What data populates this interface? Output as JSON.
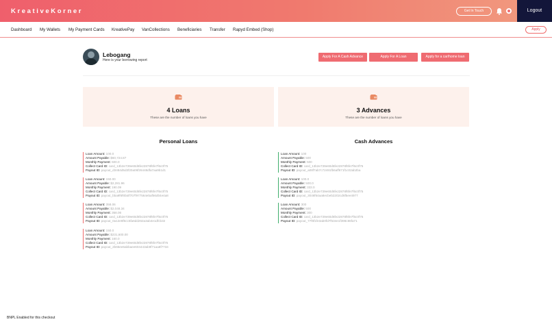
{
  "header": {
    "brand": "KreativeKorner",
    "get_in_touch": "Get In Touch",
    "logout": "Logout"
  },
  "nav": {
    "items": [
      "Dashboard",
      "My Wallets",
      "My Payment Cards",
      "KreativePay",
      "VanCollections",
      "Beneficiaries",
      "Transfer",
      "Rapyd Embed (Shop)"
    ],
    "apply": "Apply"
  },
  "profile": {
    "name": "Lebogang",
    "subtitle": "Here is your borrowing report"
  },
  "actions": [
    "Apply For A Cash Advance",
    "Apply For A Loan",
    "Apply for a car/home loan"
  ],
  "summary": {
    "loans_count": "4 Loans",
    "loans_desc": "These are the number of loans you have",
    "advances_count": "3 Advances",
    "advances_desc": "These are the number of loans you have"
  },
  "sections": {
    "loans_title": "Personal Loans",
    "advances_title": "Cash Advances"
  },
  "labels": {
    "loan_amount": "Loan Amount:",
    "amount_payable": "Amount Payable:",
    "monthly_payment": "Monthly Payment:",
    "collect_card": "Collect Card ID:",
    "payout": "Payout ID:"
  },
  "loans": [
    {
      "loan_amount": "100.0",
      "amount_payable": "$60,724.87",
      "monthly_payment": "600.0",
      "collect_card": "card_13b2e739e60d6fe22878f6fe7f6c0f75",
      "payout": "payout_d3484d5d3f20a06f26448dfa7aa9b1d1"
    },
    {
      "loan_amount": "150.00",
      "amount_payable": "$2,281.96",
      "monthly_payment": "190.09",
      "collect_card": "card_13b2e739e60d6fe22878f6fe7f6c0f75",
      "payout": "payout_bba9f6f6fa0f707f977564ebaf56d04e4a8"
    },
    {
      "loan_amount": "358.06",
      "amount_payable": "$2,048.34",
      "monthly_payment": "358.06",
      "collect_card": "card_13b2e739e60d6fe22878f6fe7f6c0f75",
      "payout": "payout_0a12e8f6cc5fa6dd262a3ab4e1dfcb32"
    },
    {
      "loan_amount": "150.0",
      "amount_payable": "$231,600.00",
      "monthly_payment": "160.0",
      "collect_card": "card_13b2e739e60d6fe22878f6fe7f6c0f75",
      "payout": "payout_2b65ee6abbaee604443ab9f71aa8f7734"
    }
  ],
  "advances": [
    {
      "loan_amount": "100",
      "amount_payable": "500",
      "monthly_payment": "500",
      "collect_card": "card_13b2e739e60d6fe22878f6fe7f6c0f75",
      "payout": "payout_a08f7ab7c72491fb6aff671f1c02ab2ba"
    },
    {
      "loan_amount": "100.0",
      "amount_payable": "500.0",
      "monthly_payment": "333.0",
      "collect_card": "card_13b2e739e60d6fe22878f6fe7f6c0f75",
      "payout": "payout_3046f64aa8ecbeb2202cd6f5ee4977"
    },
    {
      "loan_amount": "300",
      "amount_payable": "500",
      "monthly_payment": "300",
      "collect_card": "card_13b2e739e60d6fe22878f6fe7f6c0f75",
      "payout": "payout_77f6f1fe3ab0fd7f534e1f398c86fa71"
    }
  ],
  "footer": {
    "note": "BNPL Enabled for this checkout"
  },
  "colors": {
    "accent": "#ef6b71",
    "nav_dark": "#13163a",
    "card_bg": "#fdf1ec",
    "loan_border": "#ef6b6b",
    "advance_border": "#3fae6b"
  }
}
